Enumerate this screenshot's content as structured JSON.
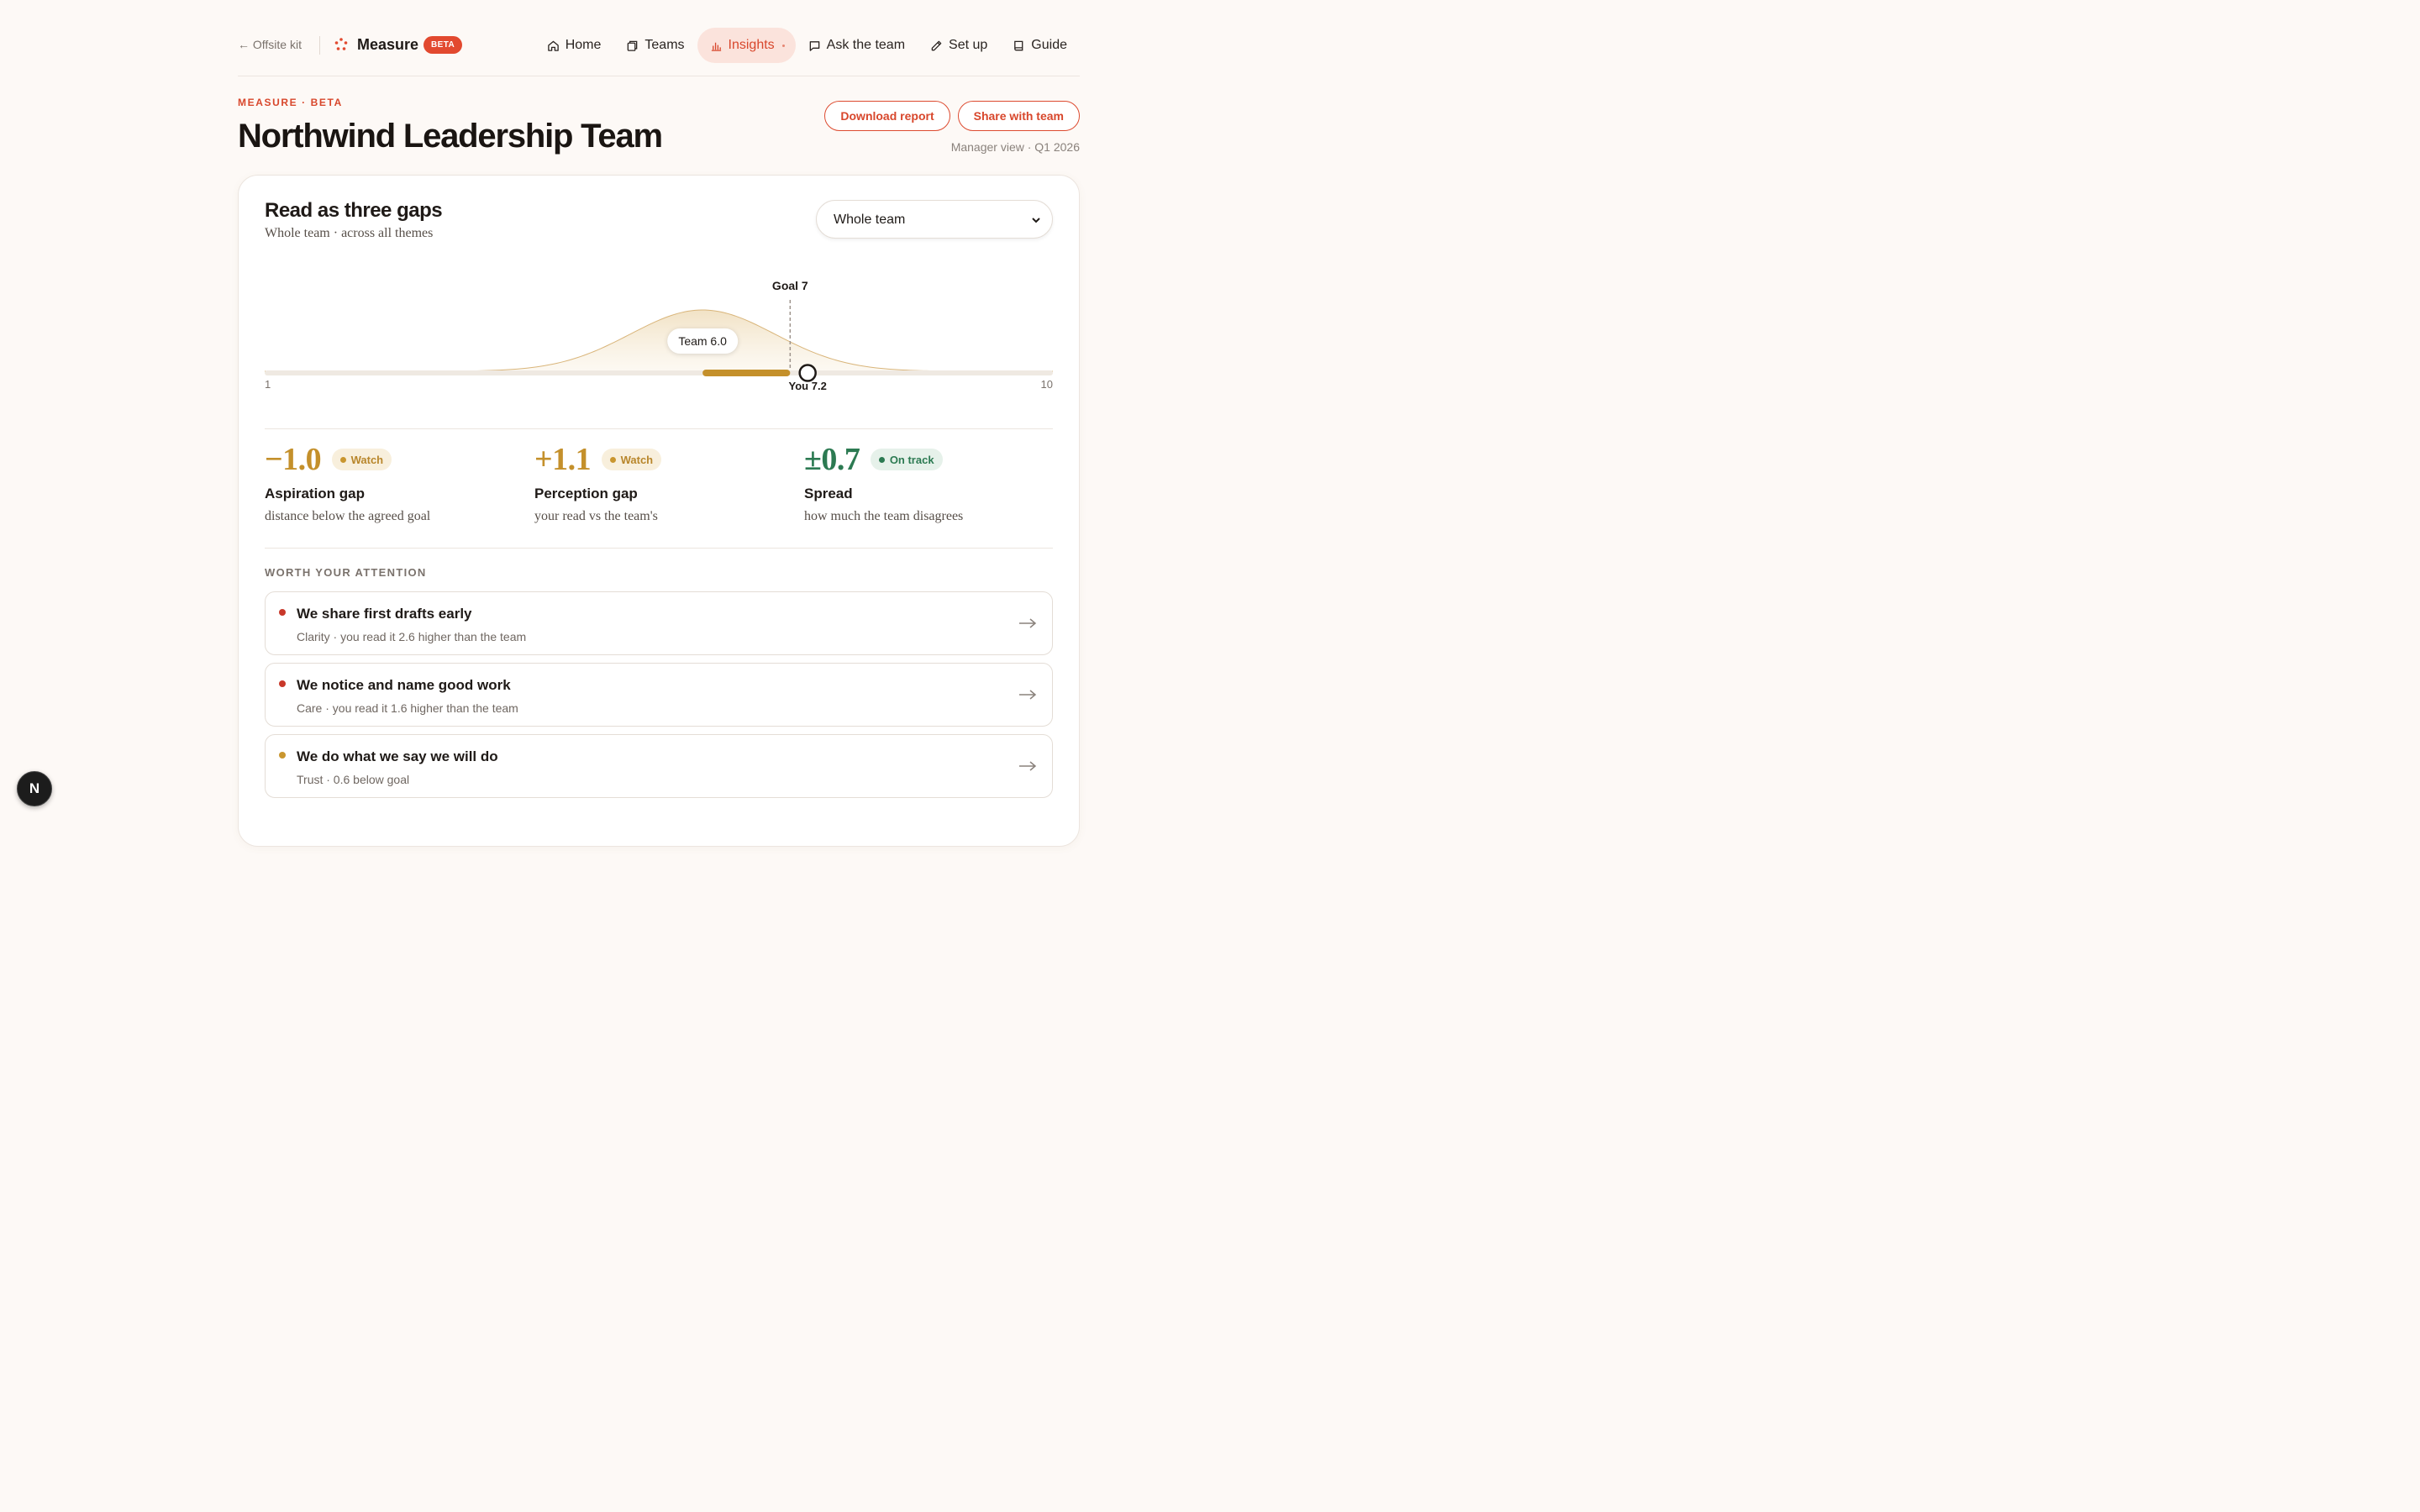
{
  "nav": {
    "back_label": "← Offsite kit",
    "brand": "Measure",
    "badge": "BETA",
    "items": [
      {
        "label": "Home",
        "icon": "home-icon"
      },
      {
        "label": "Teams",
        "icon": "copy-icon"
      },
      {
        "label": "Insights",
        "icon": "bar-chart-icon",
        "active": true
      },
      {
        "label": "Ask the team",
        "icon": "message-icon"
      },
      {
        "label": "Set up",
        "icon": "pencil-icon"
      },
      {
        "label": "Guide",
        "icon": "book-icon"
      }
    ]
  },
  "header": {
    "eyebrow": "MEASURE · BETA",
    "title": "Northwind Leadership Team",
    "download_label": "Download report",
    "share_label": "Share with team",
    "meta": "Manager view · Q1 2026"
  },
  "card": {
    "title": "Read as three gaps",
    "subtitle": "Whole team · across all themes",
    "selector_value": "Whole team"
  },
  "distribution": {
    "scale_min": 1,
    "scale_max": 10,
    "scale_min_label": "1",
    "scale_max_label": "10",
    "team_score": 6.0,
    "team_label": "Team 6.0",
    "goal": 7,
    "goal_label": "Goal 7",
    "you_score": 7.2,
    "you_label": "You 7.2"
  },
  "gaps": [
    {
      "value": "−1.0",
      "status": "Watch",
      "kind": "watch",
      "label": "Aspiration gap",
      "desc": "distance below the agreed goal"
    },
    {
      "value": "+1.1",
      "status": "Watch",
      "kind": "watch",
      "label": "Perception gap",
      "desc": "your read vs the team's"
    },
    {
      "value": "±0.7",
      "status": "On track",
      "kind": "ok",
      "label": "Spread",
      "desc": "how much the team disagrees"
    }
  ],
  "attention": {
    "label": "WORTH YOUR ATTENTION",
    "items": [
      {
        "title": "We share first drafts early",
        "sub": "Clarity · you read it 2.6 higher than the team",
        "severity": "high"
      },
      {
        "title": "We notice and name good work",
        "sub": "Care · you read it 1.6 higher than the team",
        "severity": "high"
      },
      {
        "title": "We do what we say we will do",
        "sub": "Trust · 0.6 below goal",
        "severity": "medium"
      }
    ]
  },
  "colors": {
    "accent": "#d8472c",
    "watch": "#c4902b",
    "ok": "#2c7a52",
    "high": "#c8382a",
    "medium": "#c9962f"
  },
  "dev_badge": "N"
}
